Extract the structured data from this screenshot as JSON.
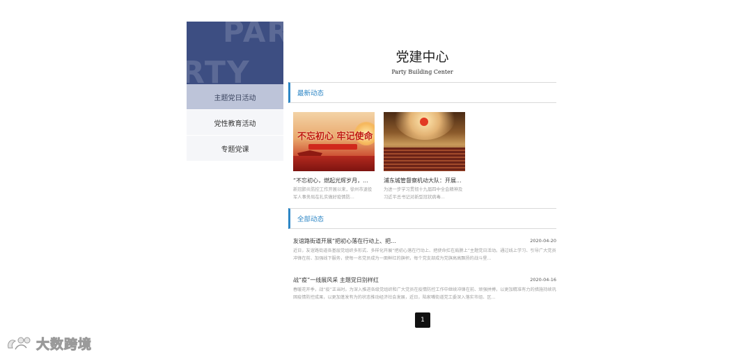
{
  "sidebar": {
    "banner_watermark_top": "PAR",
    "banner_watermark_bottom": "RTY",
    "items": [
      {
        "label": "主题党日活动",
        "active": true
      },
      {
        "label": "党性教育活动",
        "active": false
      },
      {
        "label": "专题党课",
        "active": false
      }
    ]
  },
  "header": {
    "title": "党建中心",
    "subtitle": "Party Building Center"
  },
  "latest": {
    "heading": "最新动态",
    "cards": [
      {
        "image": "不忘初心牢记使命-banner",
        "image_text": "不忘初心 牢记使命",
        "title": "“不忘初心，燃起光辉岁月，...",
        "desc": "新冠肺炎防控工作开展以来，徐州市退役军人事务局在扎实做好疫情防..."
      },
      {
        "image": "great-hall-photo",
        "title": "浦东城管督察机动大队：开展...",
        "desc": "为进一步学习贯彻十九届四中全会精神及习近平总书记对新型冠状病毒..."
      }
    ]
  },
  "all_news": {
    "heading": "全部动态",
    "items": [
      {
        "title": "友谊路街道开展“把初心落在行动上、把...",
        "date": "2020-04-20",
        "desc": "近日，友谊路街道各基层党组织多形式、多样化开展“把初心落在行动上、把使命扛在肩膀上”主题党日活动。通过线上学习、引导广大党员冲锋在前、加强线下服务，使每一名党员成为一面鲜红的旗帜，每个党支部成为党旗高高飘扬的战斗堡..."
      },
      {
        "title": "战“疫”一线展风采 主题党日别样红",
        "date": "2020-04-16",
        "desc": "春暖花开季，战“疫”正当时。为深入推进各级党组织和广大党员在疫情防控工作中继续冲锋在前、顽强拼搏，以更加精准有力的措施持续巩固疫情防控成果，以更加蓬发有为的状态推动经济社会发展，近日，陆家嘴街道党工委深入落实市组、区..."
      }
    ]
  },
  "pagination": {
    "current": "1"
  },
  "watermark": {
    "text": "大数跨境"
  },
  "colors": {
    "accent": "#2d86c5",
    "banner": "#3d4e82",
    "active_item": "#bdc4d9"
  }
}
